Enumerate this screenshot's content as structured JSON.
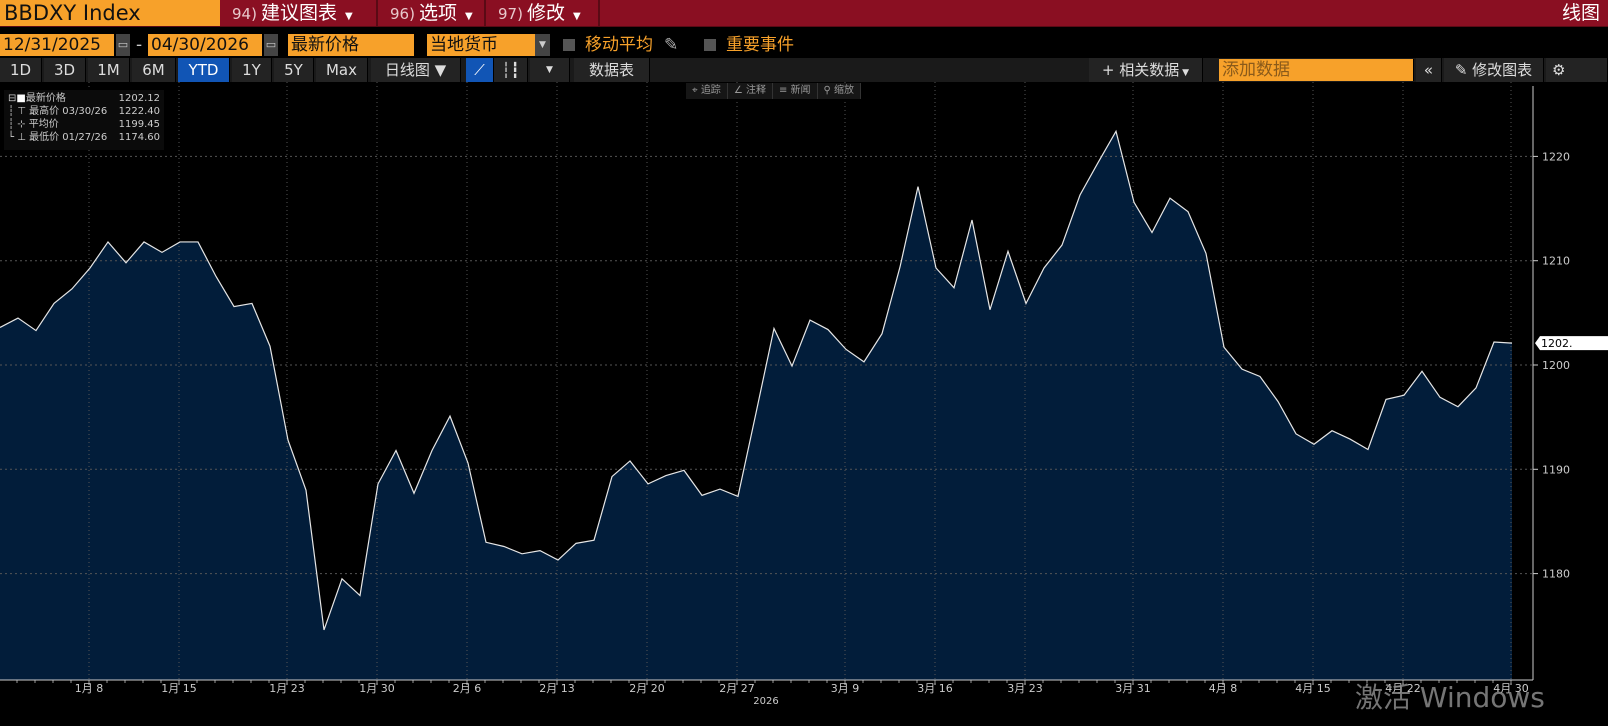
{
  "header": {
    "ticker": "BBDXY Index",
    "menus": [
      {
        "num": "94)",
        "label": "建议图表"
      },
      {
        "num": "96)",
        "label": "选项"
      },
      {
        "num": "97)",
        "label": "修改"
      }
    ],
    "title": "线图"
  },
  "controls": {
    "start_date": "12/31/2025",
    "separator": "-",
    "end_date": "04/30/2026",
    "field": "最新价格",
    "currency": "当地货币",
    "moving_average": "移动平均",
    "key_events": "重要事件"
  },
  "toolbar": {
    "periods": [
      "1D",
      "3D",
      "1M",
      "6M",
      "YTD",
      "1Y",
      "5Y",
      "Max"
    ],
    "active_period": "YTD",
    "frequency": "日线图 ▼",
    "data_table": "数据表",
    "related_data": "相关数据",
    "add_data_placeholder": "添加数据",
    "edit_chart": "修改图表"
  },
  "annotation_tools": [
    "追踪",
    "注释",
    "新闻",
    "缩放"
  ],
  "legend": {
    "last": {
      "label": "最新价格",
      "value": "1202.12"
    },
    "high": {
      "label": "最高价",
      "date": "03/30/26",
      "value": "1222.40"
    },
    "avg": {
      "label": "平均价",
      "value": "1199.45"
    },
    "low": {
      "label": "最低价",
      "date": "01/27/26",
      "value": "1174.60"
    }
  },
  "watermark": "激活 Windows",
  "colors": {
    "accent": "#f7a12a",
    "header": "#8a0f22",
    "area": "#021d3a",
    "line": "#e6e6e6"
  },
  "chart_data": {
    "type": "area",
    "series": [
      {
        "values": [
          1203.6,
          1204.5,
          1203.3,
          1205.9,
          1207.3,
          1209.3,
          1211.8,
          1209.8,
          1211.8,
          1210.8,
          1211.8,
          1211.8,
          1208.5,
          1205.6,
          1205.9,
          1201.8,
          1192.8,
          1188.0,
          1174.6,
          1179.5,
          1177.9,
          1188.6,
          1191.8,
          1187.7,
          1191.8,
          1195.1,
          1190.6,
          1183.0,
          1182.6,
          1181.9,
          1182.2,
          1181.3,
          1182.9,
          1183.2,
          1189.3,
          1190.8,
          1188.6,
          1189.4,
          1189.9,
          1187.5,
          1188.1,
          1187.4,
          1195.4,
          1203.5,
          1199.9,
          1204.3,
          1203.4,
          1201.5,
          1200.3,
          1203.0,
          1209.4,
          1217.1,
          1209.3,
          1207.4,
          1213.9,
          1205.3,
          1210.9,
          1205.9,
          1209.3,
          1211.5,
          1216.3,
          1219.4,
          1222.4,
          1215.6,
          1212.7,
          1216.0,
          1214.7,
          1210.7,
          1201.7,
          1199.6,
          1198.9,
          1196.5,
          1193.4,
          1192.4,
          1193.7,
          1192.9,
          1191.9,
          1196.7,
          1197.1,
          1199.4,
          1196.9,
          1196.0,
          1197.8,
          1202.2,
          1202.1
        ]
      }
    ],
    "x_ticks": [
      "1月 8",
      "1月 15",
      "1月 23",
      "1月 30",
      "2月 6",
      "2月 13",
      "2月 20",
      "2月 27",
      "3月 9",
      "3月 16",
      "3月 23",
      "3月 31",
      "4月 8",
      "4月 15",
      "4月 22",
      "4月 30"
    ],
    "x_year_label": "2026",
    "y_ticks": [
      "1180",
      "1190",
      "1200",
      "1210",
      "1220"
    ],
    "ylim": [
      1172.5,
      1227.6
    ],
    "last_value_label": "1202.",
    "grid": true
  }
}
